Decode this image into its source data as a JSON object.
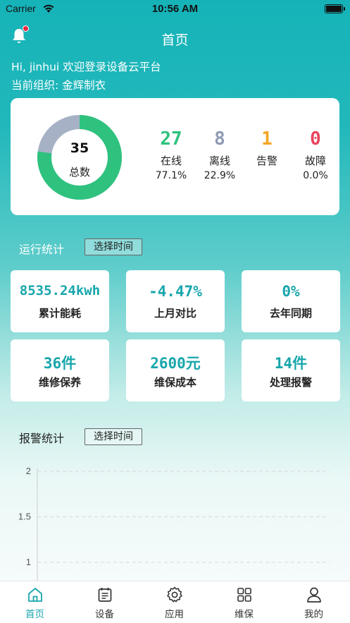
{
  "status_bar": {
    "carrier": "Carrier",
    "time": "10:56 AM"
  },
  "header": {
    "title": "首页"
  },
  "greeting": {
    "line1": "Hi, jinhui 欢迎登录设备云平台",
    "line2": "当前组织: 金辉制衣"
  },
  "summary": {
    "total": "35",
    "total_label": "总数",
    "online": {
      "count": "27",
      "label": "在线",
      "percent": "77.1%",
      "color": "#2ec27e"
    },
    "offline": {
      "count": "8",
      "label": "离线",
      "percent": "22.9%",
      "color": "#8e9bb3"
    },
    "alarm": {
      "count": "1",
      "label": "告警",
      "percent": "",
      "color": "#f5a623"
    },
    "fault": {
      "count": "0",
      "label": "故障",
      "percent": "0.0%",
      "color": "#e8455e"
    }
  },
  "run_stats": {
    "title": "运行统计",
    "select_time": "选择时间",
    "items": [
      {
        "value": "8535.24kwh",
        "label": "累计能耗"
      },
      {
        "value": "-4.47%",
        "label": "上月对比"
      },
      {
        "value": "0%",
        "label": "去年同期"
      },
      {
        "value": "36件",
        "label": "维修保养"
      },
      {
        "value": "2600元",
        "label": "维保成本"
      },
      {
        "value": "14件",
        "label": "处理报警"
      }
    ]
  },
  "alarm_stats": {
    "title": "报警统计",
    "select_time": "选择时间"
  },
  "chart_data": {
    "type": "line",
    "title": "",
    "xlabel": "",
    "ylabel": "",
    "y_ticks": [
      "2",
      "1.5",
      "1"
    ],
    "ylim": [
      1,
      2
    ],
    "grid": true,
    "series": []
  },
  "tabbar": {
    "items": [
      {
        "label": "首页",
        "icon": "home-icon"
      },
      {
        "label": "设备",
        "icon": "device-icon"
      },
      {
        "label": "应用",
        "icon": "gear-icon"
      },
      {
        "label": "维保",
        "icon": "grid-icon"
      },
      {
        "label": "我的",
        "icon": "user-icon"
      }
    ],
    "active_color": "#17a6ac"
  }
}
